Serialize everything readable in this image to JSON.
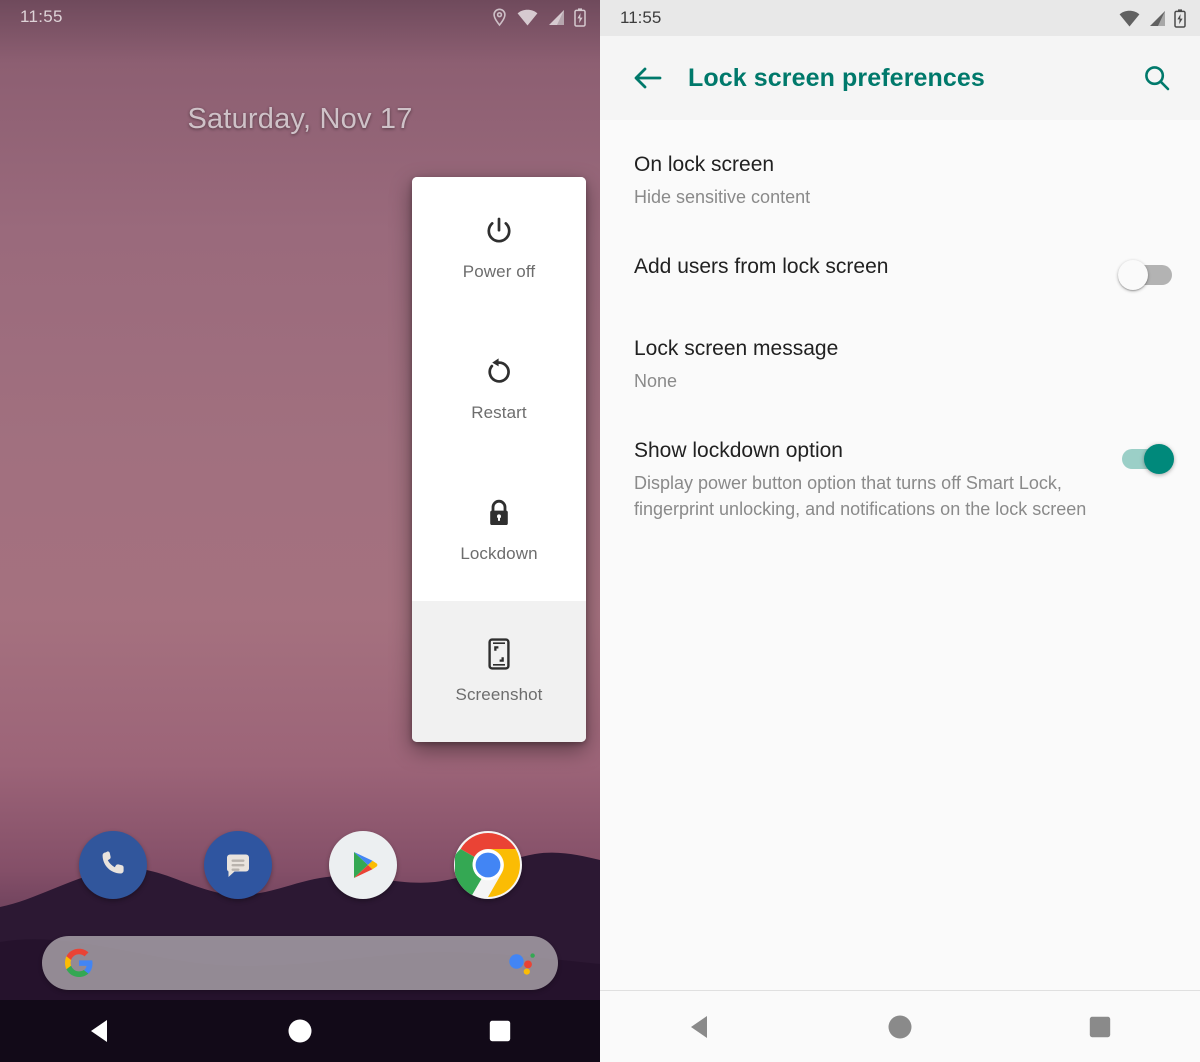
{
  "left_phone": {
    "statusbar": {
      "clock": "11:55",
      "icons": [
        "location-icon",
        "wifi-icon",
        "signal-icon",
        "battery-charging-icon"
      ]
    },
    "home": {
      "date": "Saturday, Nov 17"
    },
    "power_menu": {
      "items": [
        {
          "label": "Power off",
          "icon": "power-icon",
          "highlighted": false
        },
        {
          "label": "Restart",
          "icon": "restart-icon",
          "highlighted": false
        },
        {
          "label": "Lockdown",
          "icon": "lock-icon",
          "highlighted": false
        },
        {
          "label": "Screenshot",
          "icon": "screenshot-icon",
          "highlighted": true
        }
      ]
    },
    "dock": {
      "apps": [
        {
          "name": "Phone",
          "icon": "phone-icon"
        },
        {
          "name": "Messages",
          "icon": "messages-icon"
        },
        {
          "name": "Play Store",
          "icon": "play-store-icon"
        },
        {
          "name": "Chrome",
          "icon": "chrome-icon"
        }
      ]
    },
    "search": {
      "placeholder": "",
      "value": "",
      "left_icon": "google-g-icon",
      "right_icon": "google-assistant-icon"
    },
    "navbar": {
      "buttons": [
        {
          "name": "back",
          "icon": "back-triangle-icon"
        },
        {
          "name": "home",
          "icon": "home-circle-icon"
        },
        {
          "name": "recents",
          "icon": "recents-square-icon"
        }
      ]
    }
  },
  "right_phone": {
    "statusbar": {
      "clock": "11:55",
      "icons": [
        "wifi-icon",
        "signal-icon",
        "battery-charging-icon"
      ]
    },
    "header": {
      "title": "Lock screen preferences",
      "back_icon": "arrow-back-icon",
      "search_icon": "search-icon",
      "accent_color": "#00796b"
    },
    "preferences": [
      {
        "title": "On lock screen",
        "summary": "Hide sensitive content",
        "has_switch": false,
        "switch_on": null
      },
      {
        "title": "Add users from lock screen",
        "summary": "",
        "has_switch": true,
        "switch_on": false
      },
      {
        "title": "Lock screen message",
        "summary": "None",
        "has_switch": false,
        "switch_on": null
      },
      {
        "title": "Show lockdown option",
        "summary": "Display power button option that turns off Smart Lock, fingerprint unlocking, and notifications on the lock screen",
        "has_switch": true,
        "switch_on": true
      }
    ],
    "annotation": {
      "type": "red-arrow",
      "color": "#e01b1b",
      "points_to": "Show lockdown option switch"
    },
    "navbar": {
      "buttons": [
        {
          "name": "back",
          "icon": "back-triangle-icon"
        },
        {
          "name": "home",
          "icon": "home-circle-icon"
        },
        {
          "name": "recents",
          "icon": "recents-square-icon"
        }
      ]
    }
  }
}
